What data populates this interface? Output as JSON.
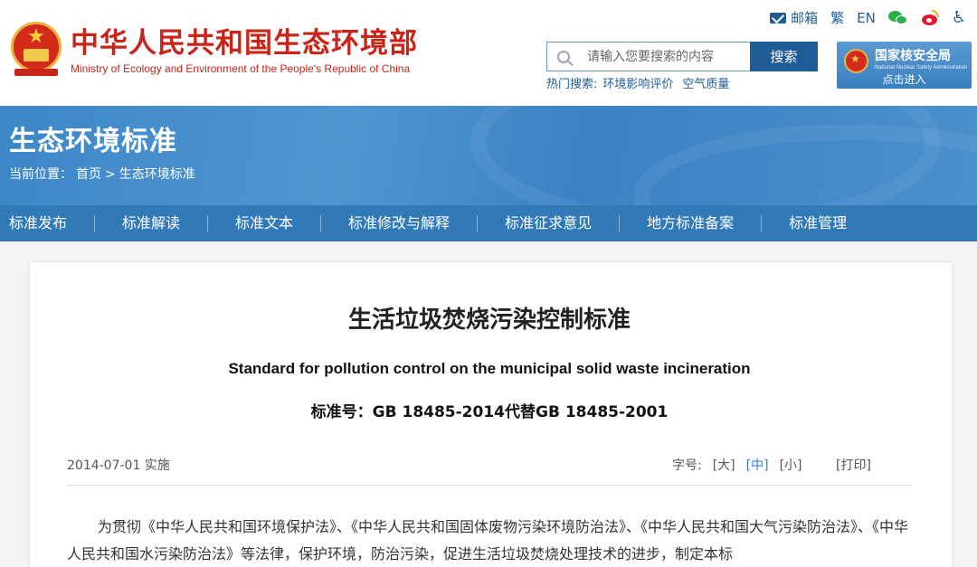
{
  "header": {
    "org_name_cn": "中华人民共和国生态环境部",
    "org_name_en": "Ministry of Ecology and Environment of the People's Republic of China",
    "top_links": {
      "mail": "邮箱",
      "traditional": "繁",
      "english": "EN"
    },
    "search": {
      "placeholder": "请输入您要搜索的内容",
      "button": "搜索"
    },
    "hot_search": {
      "label": "热门搜索:",
      "items": [
        "环境影响评价",
        "空气质量"
      ]
    },
    "nnsa": {
      "name": "国家核安全局",
      "sub": "National Nuclear Safety Administration",
      "enter": "点击进入"
    }
  },
  "banner": {
    "title": "生态环境标准",
    "breadcrumb": {
      "prefix": "当前位置：",
      "home": "首页",
      "sep": ">",
      "current": "生态环境标准"
    }
  },
  "nav": {
    "items": [
      "标准发布",
      "标准解读",
      "标准文本",
      "标准修改与解释",
      "标准征求意见",
      "地方标准备案",
      "标准管理"
    ]
  },
  "document": {
    "title": "生活垃圾焚烧污染控制标准",
    "title_en": "Standard for pollution control on the municipal solid waste incineration",
    "number": "标准号：GB 18485-2014代替GB 18485-2001",
    "date": "2014-07-01 实施",
    "font_size": {
      "label": "字号:",
      "large": "[大]",
      "medium": "[中]",
      "small": "[小]",
      "active": "medium"
    },
    "print": "[打印]",
    "body": "为贯彻《中华人民共和国环境保护法》、《中华人民共和国固体废物污染环境防治法》、《中华人民共和国大气污染防治法》、《中华人民共和国水污染防治法》等法律，保护环境，防治污染，促进生活垃圾焚烧处理技术的进步，制定本标"
  },
  "colors": {
    "brand_red": "#c8241a",
    "brand_blue": "#1e5c96",
    "nav_blue": "#3279b7",
    "active_link": "#2f7fcf"
  }
}
